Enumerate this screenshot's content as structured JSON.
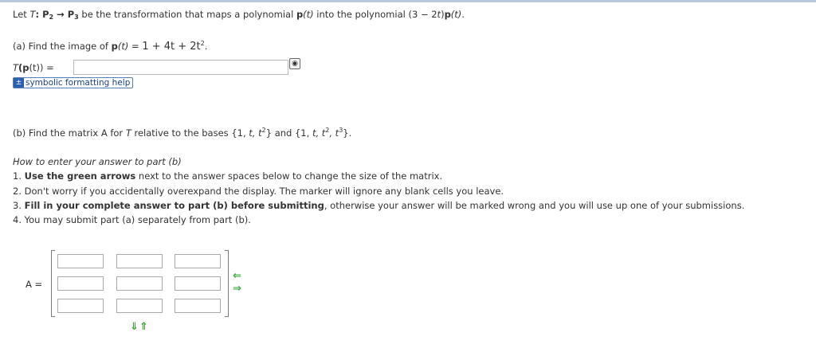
{
  "problem": {
    "intro_prefix": "Let",
    "T": "T",
    "colon_P2": ": P",
    "sub2": "2",
    "arrow": " → P",
    "sub3": "3",
    "intro_suffix": " be the transformation that maps a polynomial ",
    "p": "p",
    "t_paren": "(t)",
    "into_text": " into the polynomial (3 − 2",
    "t2": "t",
    "close": ")",
    "p2": "p",
    "t3": "(t)",
    "period": "."
  },
  "part_a": {
    "label": "(a) Find the image of ",
    "p": "p",
    "pt": "(t)",
    "equals": " = ",
    "poly": "1 + 4t + 2t",
    "exp": "2",
    "period": ".",
    "answer_label_T": "T",
    "answer_label_p": "(p",
    "answer_label_rest": "(t)) =",
    "answer_value": "",
    "preview_icon": "eye-icon",
    "help_label": "symbolic formatting help"
  },
  "part_b": {
    "label": "(b) Find the matrix A for ",
    "T": "T",
    "mid": " relative to the bases {1, ",
    "basis1": "t, t",
    "exp1": "2",
    "and": "} and {1, ",
    "basis2": "t, t",
    "exp2": "2",
    "basis2b": ", t",
    "exp3": "3",
    "end": "}."
  },
  "howto": {
    "title": "How to enter your answer to part (b)",
    "items": [
      {
        "num": "1.",
        "bold": "Use the green arrows",
        "rest": " next to the answer spaces below to change the size of the matrix."
      },
      {
        "num": "2.",
        "bold": "",
        "rest": "Don't worry if you accidentally overexpand the display. The marker will ignore any blank cells you leave."
      },
      {
        "num": "3.",
        "bold": "Fill in your complete answer to part (b) before submitting",
        "rest": ", otherwise your answer will be marked wrong and you will use up one of your submissions."
      },
      {
        "num": "4.",
        "bold": "",
        "rest": "You may submit part (a) separately from part (b)."
      }
    ]
  },
  "matrix": {
    "label": "A =",
    "rows": 3,
    "cols": 3,
    "values": [
      [
        "",
        "",
        ""
      ],
      [
        "",
        "",
        ""
      ],
      [
        "",
        "",
        ""
      ]
    ],
    "col_shrink_icon": "arrow-left-icon",
    "col_expand_icon": "arrow-right-icon",
    "row_expand_icon": "arrow-down-icon",
    "row_shrink_icon": "arrow-up-icon",
    "arrow_color": "#3aa13a"
  }
}
